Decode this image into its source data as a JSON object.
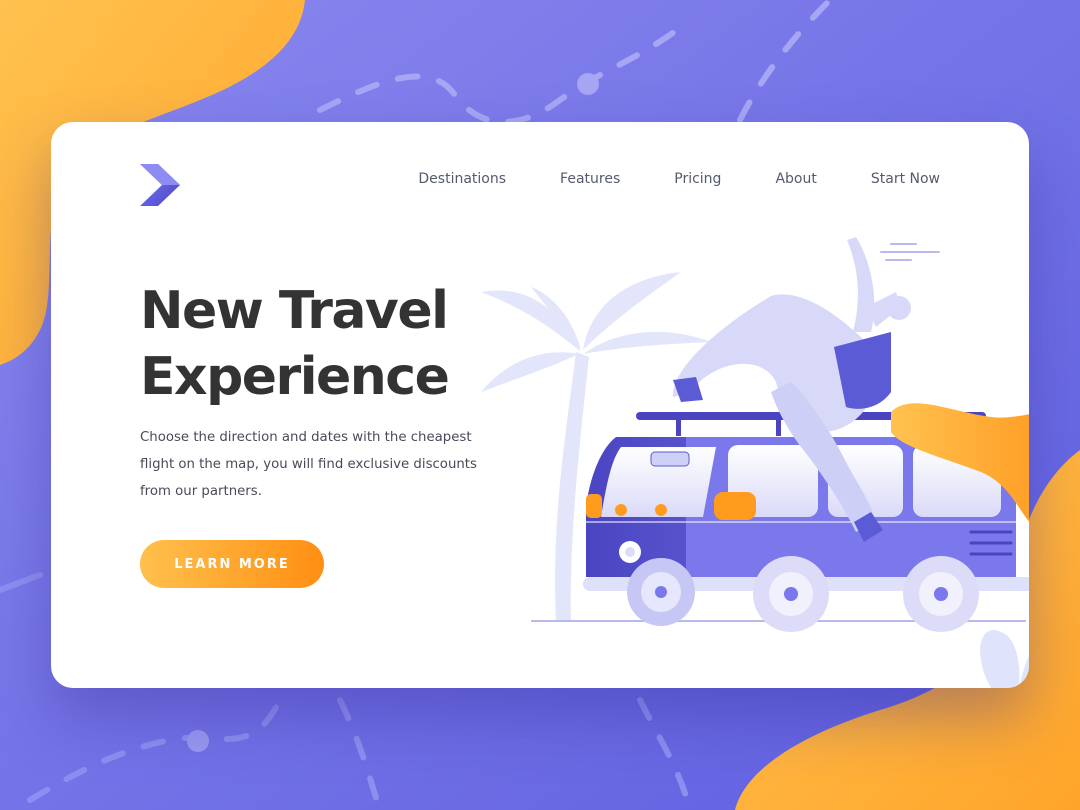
{
  "brand": {
    "logo_icon": "chevron-arrow-logo"
  },
  "nav": {
    "items": [
      {
        "label": "Destinations"
      },
      {
        "label": "Features"
      },
      {
        "label": "Pricing"
      },
      {
        "label": "About"
      },
      {
        "label": "Start Now"
      }
    ]
  },
  "hero": {
    "title_line1": "New Travel",
    "title_line2": "Experience",
    "description": "Choose the direction and dates with the cheapest flight on the map, you will find exclusive discounts from our partners.",
    "cta_label": "LEARN MORE"
  },
  "colors": {
    "background": "#6f6fe8",
    "accent_orange": "#ff8f12",
    "accent_yellow": "#ffc04d",
    "brand_purple": "#5b5bd6"
  }
}
